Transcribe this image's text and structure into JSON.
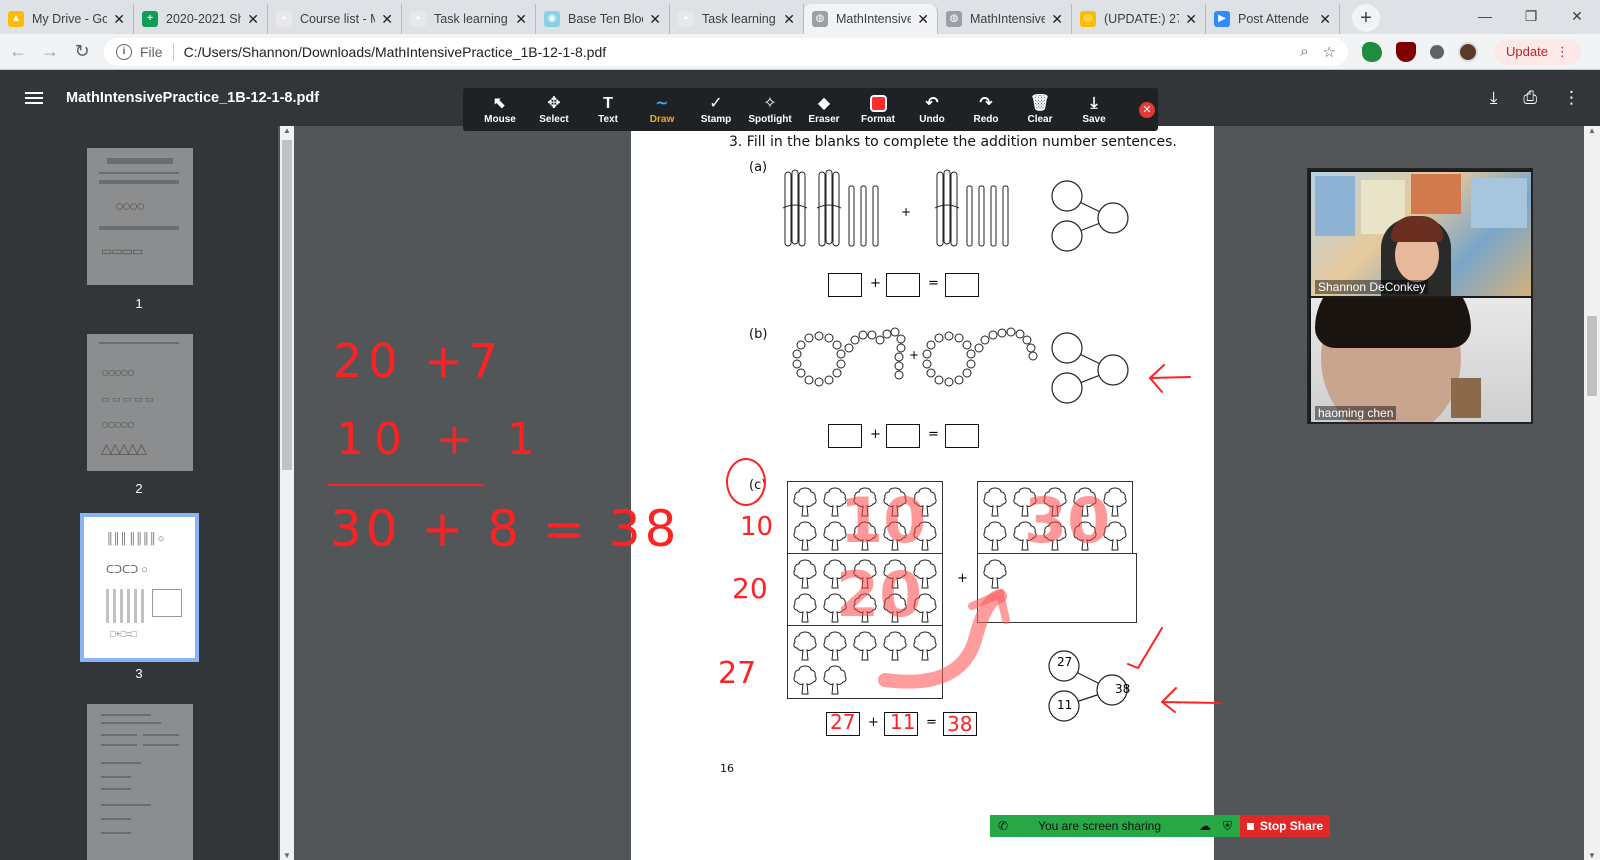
{
  "browser": {
    "tabs": [
      {
        "title": "My Drive - Go",
        "color": "#fbbc04",
        "glyph": "▲"
      },
      {
        "title": "2020-2021 Sh",
        "color": "#0f9d58",
        "glyph": "+"
      },
      {
        "title": "Course list - M",
        "color": "#e8e8e8",
        "glyph": "▪"
      },
      {
        "title": "Task learning",
        "color": "#e8e8e8",
        "glyph": "▪"
      },
      {
        "title": "Base Ten Bloc",
        "color": "#8ad1e6",
        "glyph": "◉"
      },
      {
        "title": "Task learning",
        "color": "#e8e8e8",
        "glyph": "▪"
      },
      {
        "title": "MathIntensive",
        "color": "#9aa0a6",
        "glyph": "◍"
      },
      {
        "title": "MathIntensive",
        "color": "#9aa0a6",
        "glyph": "◍"
      },
      {
        "title": "(UPDATE:) 27",
        "color": "#fbbc04",
        "glyph": "◎"
      },
      {
        "title": "Post Attende",
        "color": "#2d8cff",
        "glyph": "▶"
      }
    ],
    "new_tab": "+",
    "window_controls": [
      "—",
      "❐",
      "✕"
    ],
    "address": {
      "scheme": "File",
      "url": "C:/Users/Shannon/Downloads/MathIntensivePractice_1B-12-1-8.pdf"
    },
    "update_label": "Update"
  },
  "pdf": {
    "title": "MathIntensivePractice_1B-12-1-8.pdf",
    "thumbnails": [
      {
        "label": "1"
      },
      {
        "label": "2"
      },
      {
        "label": "3"
      },
      {
        "label": ""
      }
    ]
  },
  "annotation_toolbar": {
    "tools": [
      {
        "name": "mouse",
        "label": "Mouse",
        "glyph": "⬉"
      },
      {
        "name": "select",
        "label": "Select",
        "glyph": "✥"
      },
      {
        "name": "text",
        "label": "Text",
        "glyph": "T"
      },
      {
        "name": "draw",
        "label": "Draw",
        "glyph": "∼"
      },
      {
        "name": "stamp",
        "label": "Stamp",
        "glyph": "✓"
      },
      {
        "name": "spotlight",
        "label": "Spotlight",
        "glyph": "✧"
      },
      {
        "name": "eraser",
        "label": "Eraser",
        "glyph": "◆"
      },
      {
        "name": "format",
        "label": "Format",
        "glyph": ""
      },
      {
        "name": "undo",
        "label": "Undo",
        "glyph": "↶"
      },
      {
        "name": "redo",
        "label": "Redo",
        "glyph": "↷"
      },
      {
        "name": "clear",
        "label": "Clear",
        "glyph": "🗑"
      },
      {
        "name": "save",
        "label": "Save",
        "glyph": "⤓"
      }
    ],
    "active_tool": "Draw",
    "format_color": "#ff2b2b"
  },
  "worksheet": {
    "question": "3.  Fill in the blanks to complete the addition number sentences.",
    "part_a": "(a)",
    "part_b": "(b)",
    "part_c": "(c)",
    "plus": "+",
    "equals": "=",
    "page_number": "16",
    "bond_values": {
      "top": "27",
      "bottom": "11",
      "whole": "38"
    },
    "filled_answers": {
      "addend1": "27",
      "addend2": "11",
      "sum": "38"
    }
  },
  "ink_annotations": {
    "line1": "20 +7",
    "line2": "10 + 1",
    "line3": "30 + 8 = 38",
    "row_label_1": "10",
    "row_label_2": "20",
    "row_label_3": "27",
    "overlay_1": "10",
    "overlay_2": "30",
    "overlay_3": "20"
  },
  "zoom": {
    "participants": [
      {
        "name": "Shannon DeConkey"
      },
      {
        "name": "haoming chen"
      }
    ],
    "sharing_label": "You are screen sharing",
    "stop_label": "Stop Share"
  }
}
